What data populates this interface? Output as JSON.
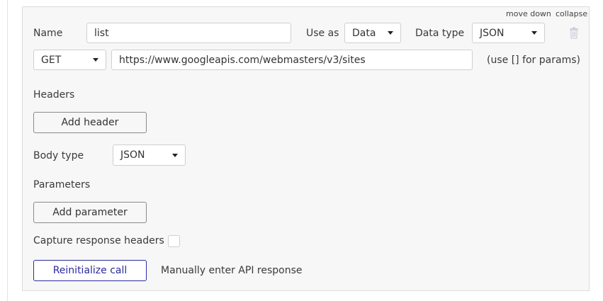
{
  "header": {
    "move_down": "move down",
    "collapse": "collapse"
  },
  "call": {
    "name_label": "Name",
    "name_value": "list",
    "use_as_label": "Use as",
    "use_as_value": "Data",
    "data_type_label": "Data type",
    "data_type_value": "JSON",
    "method_value": "GET",
    "url_value": "https://www.googleapis.com/webmasters/v3/sites",
    "url_hint": "(use [] for params)"
  },
  "headers_section": {
    "title": "Headers",
    "add_label": "Add header"
  },
  "body_section": {
    "label": "Body type",
    "value": "JSON"
  },
  "params_section": {
    "title": "Parameters",
    "add_label": "Add parameter"
  },
  "capture": {
    "label": "Capture response headers"
  },
  "actions": {
    "reinit_label": "Reinitialize call",
    "manual_label": "Manually enter API response"
  },
  "colors": {
    "accent": "#2a2a9c",
    "panel_bg": "#f7f7f7",
    "border": "#cfcfcf"
  }
}
